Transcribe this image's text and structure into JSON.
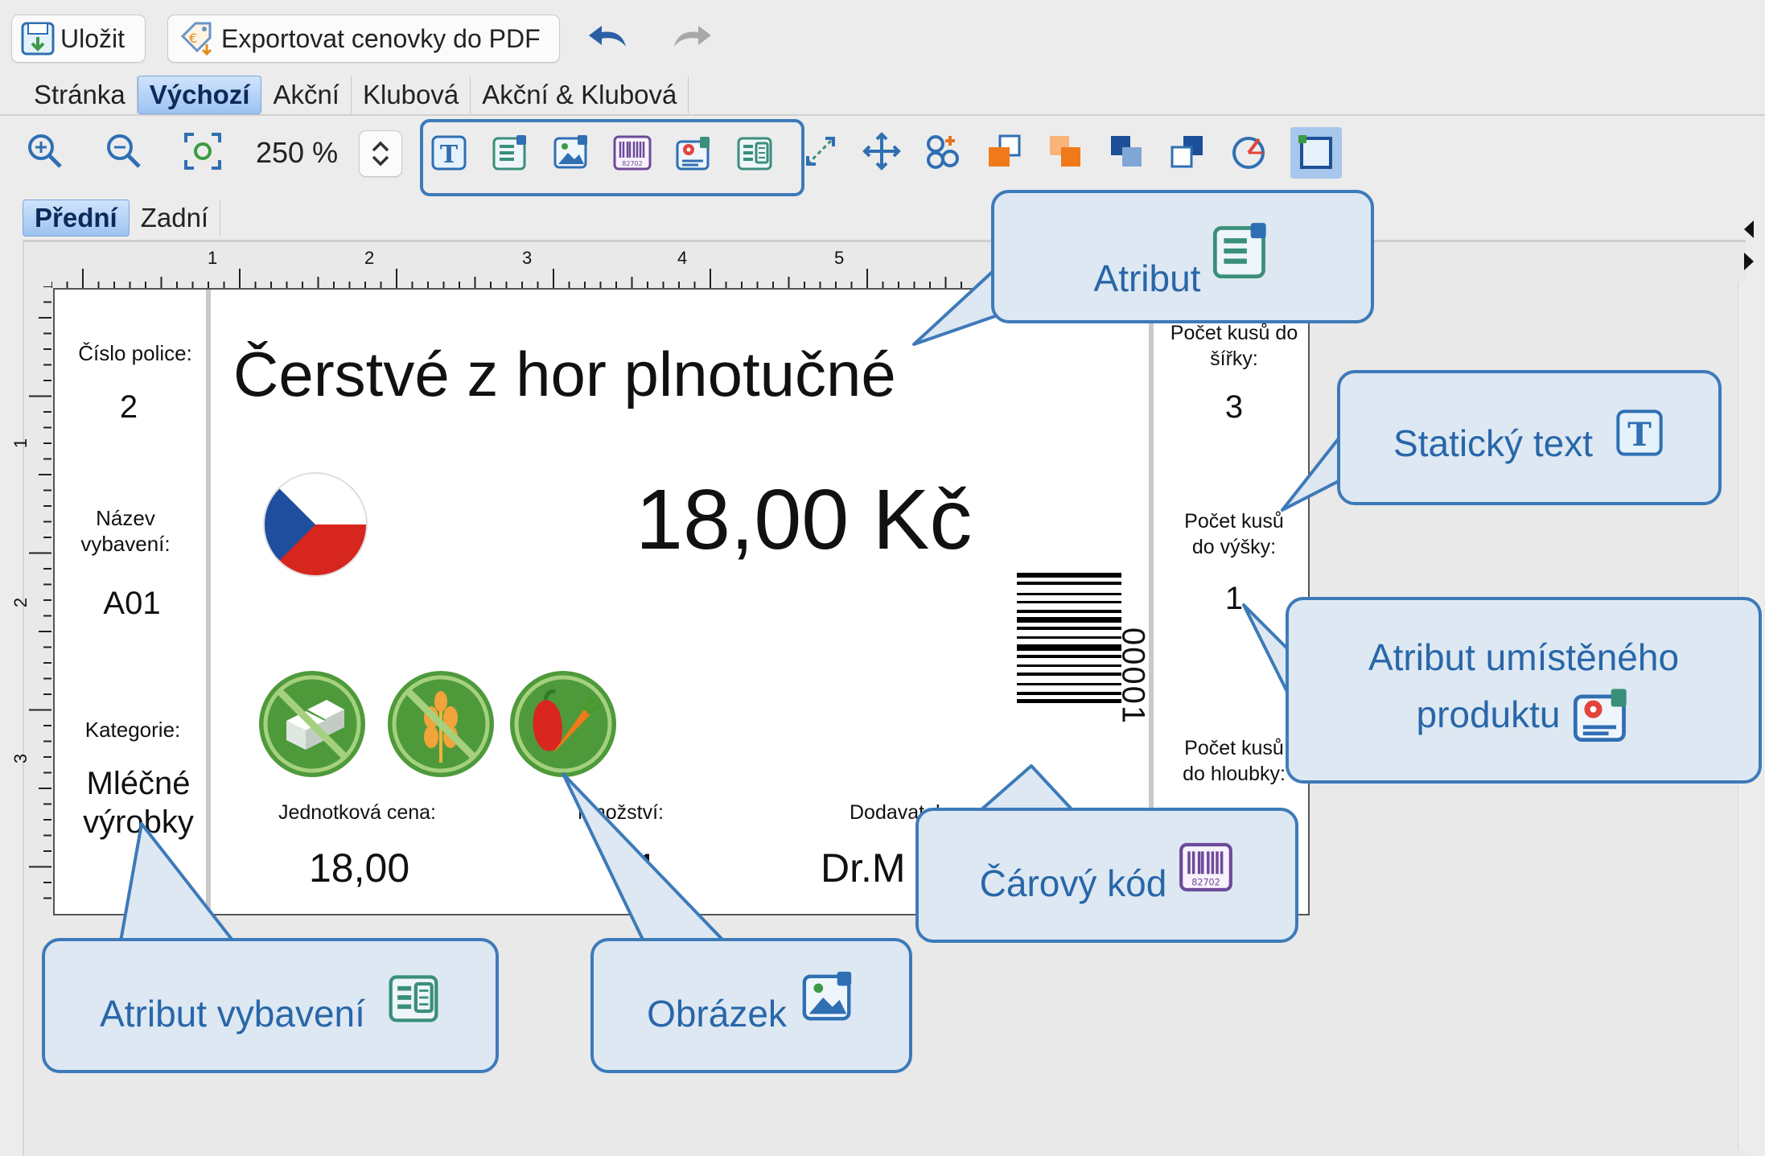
{
  "toolbar": {
    "save_label": "Uložit",
    "export_label": "Exportovat cenovky do PDF",
    "zoom_value": "250 %"
  },
  "menu_tabs": [
    {
      "label": "Stránka"
    },
    {
      "label": "Výchozí"
    },
    {
      "label": "Akční"
    },
    {
      "label": "Klubová"
    },
    {
      "label": "Akční & Klubová"
    }
  ],
  "side_tabs": [
    {
      "label": "Přední"
    },
    {
      "label": "Zadní"
    }
  ],
  "ruler": {
    "h_ticks": [
      "1",
      "2",
      "3",
      "4",
      "5"
    ],
    "v_ticks": [
      "1",
      "2",
      "3"
    ]
  },
  "label_card": {
    "left": {
      "shelf_label": "Číslo police:",
      "shelf_value": "2",
      "equip_label": "Název vybavení:",
      "equip_value": "A01",
      "category_label": "Kategorie:",
      "category_value": "Mléčné výrobky"
    },
    "title": "Čerstvé z hor plnotučné",
    "price": "18,00 Kč",
    "unit_price_label": "Jednotková cena:",
    "unit_price_value": "18,00",
    "qty_label": "Množství:",
    "qty_value": "1",
    "supplier_label": "Dodavatel:",
    "supplier_value": "Dr.M",
    "barcode_text": "00001",
    "right": {
      "width_label": "Počet kusů do šířky:",
      "width_value": "3",
      "height_label": "Počet kusů do výšky:",
      "height_value": "1",
      "depth_label": "Počet kusů do hloubky:"
    }
  },
  "callouts": {
    "attribute": "Atribut",
    "static_text": "Statický text",
    "placed_product_line1": "Atribut umístěného",
    "placed_product_line2": "produktu",
    "barcode": "Čárový kód",
    "equipment_attribute": "Atribut vybavení",
    "image": "Obrázek",
    "barcode_icon_digits": "82702"
  },
  "colors": {
    "accent": "#3d7ab9",
    "callout_bg": "#dde8f3",
    "callout_text": "#2866a8",
    "icon_green": "#4e9a3b",
    "flag_blue": "#1f4e9e",
    "flag_red": "#d7261e"
  }
}
